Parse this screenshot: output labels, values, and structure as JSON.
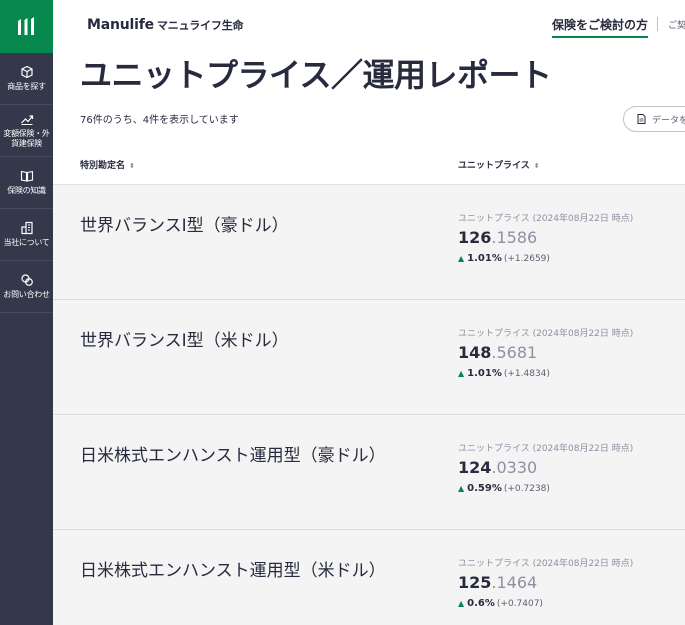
{
  "colors": {
    "brand_green": "#06874e",
    "sidebar_bg": "#34384b",
    "text": "#282b3e",
    "muted": "#8e90a2"
  },
  "sidebar": {
    "logo_icon": "manulife-logo-icon",
    "items": [
      {
        "label": "商品を探す",
        "icon": "box-icon"
      },
      {
        "label": "変額保険・外",
        "label2": "貨建保険",
        "icon": "trend-up-icon"
      },
      {
        "label": "保険の知識",
        "icon": "book-icon"
      },
      {
        "label": "当社について",
        "icon": "building-icon"
      },
      {
        "label": "お問い合わせ",
        "icon": "chat-bubbles-icon"
      }
    ]
  },
  "header": {
    "brand": "Manulife",
    "brand_sub": "マニュライフ生命",
    "link_active": "保険をご検討の方",
    "link_other": "ご契"
  },
  "hero": {
    "title": "ユニットプライス／運用レポート",
    "count_text": "76件のうち、4件を表示しています",
    "data_button": "データを"
  },
  "table": {
    "col_name": "特別勘定名",
    "col_price": "ユニットプライス",
    "sort_symbol": "⬍",
    "rows": [
      {
        "name": "世界バランスⅠ型（豪ドル）",
        "label": "ユニットプライス (2024年08月22日 時点)",
        "price_int": "126",
        "price_dec": ".1586",
        "change_pct": "1.01%",
        "change_abs": "(+1.2659)"
      },
      {
        "name": "世界バランスⅠ型（米ドル）",
        "label": "ユニットプライス (2024年08月22日 時点)",
        "price_int": "148",
        "price_dec": ".5681",
        "change_pct": "1.01%",
        "change_abs": "(+1.4834)"
      },
      {
        "name": "日米株式エンハンスト運用型（豪ドル）",
        "label": "ユニットプライス (2024年08月22日 時点)",
        "price_int": "124",
        "price_dec": ".0330",
        "change_pct": "0.59%",
        "change_abs": "(+0.7238)"
      },
      {
        "name": "日米株式エンハンスト運用型（米ドル）",
        "label": "ユニットプライス (2024年08月22日 時点)",
        "price_int": "125",
        "price_dec": ".1464",
        "change_pct": "0.6%",
        "change_abs": "(+0.7407)"
      }
    ]
  }
}
